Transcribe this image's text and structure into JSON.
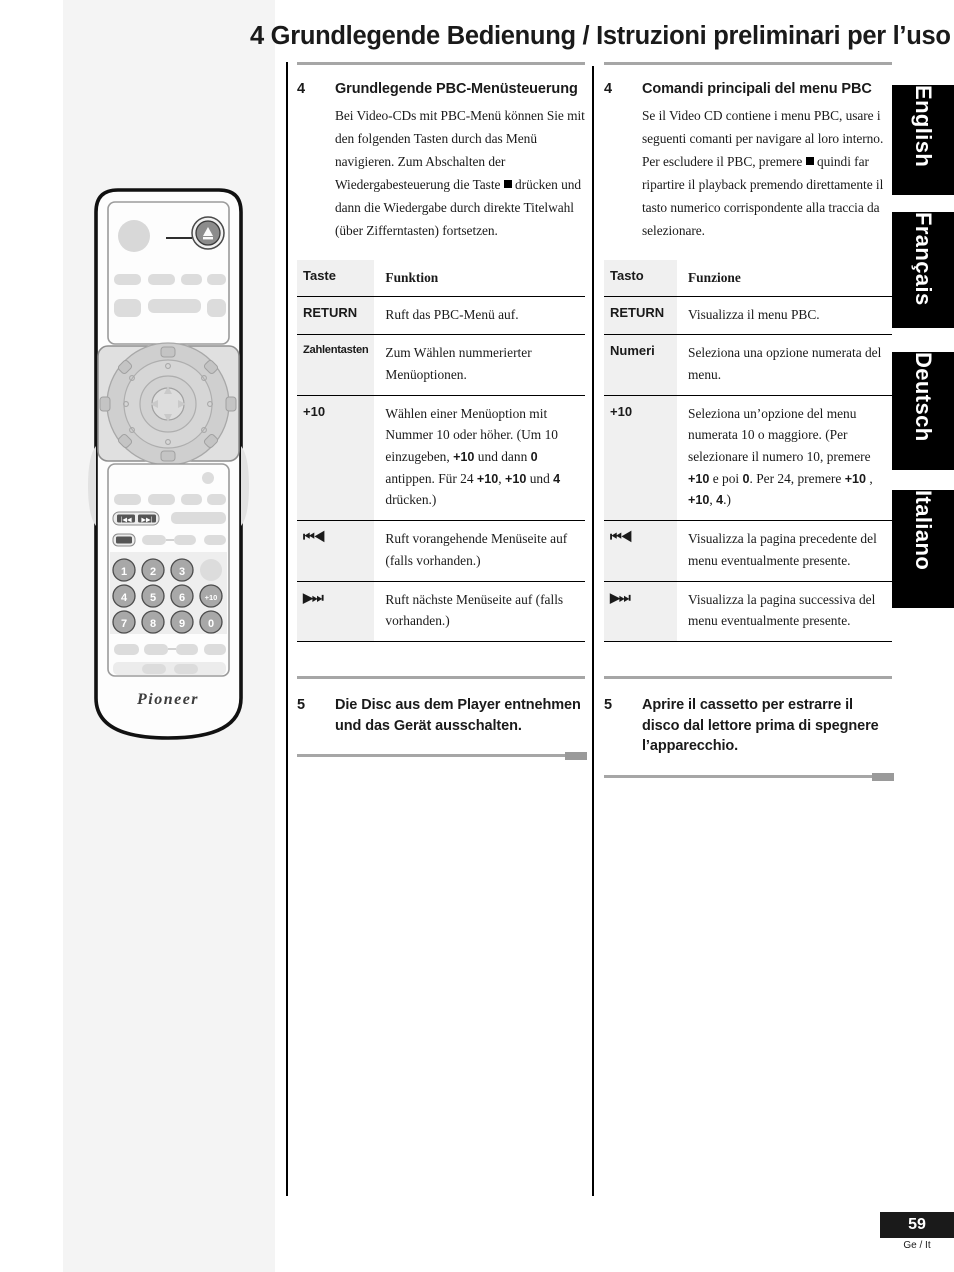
{
  "page": {
    "title": "4 Grundlegende Bedienung / Istruzioni preliminari per l’uso",
    "number": "59",
    "number_sub": "Ge / It"
  },
  "language_tabs": [
    {
      "label": "English"
    },
    {
      "label": "Français"
    },
    {
      "label": "Deutsch"
    },
    {
      "label": "Italiano"
    }
  ],
  "illustration": {
    "brand": "Pioneer",
    "numeric_keys": [
      "1",
      "2",
      "3",
      "4",
      "5",
      "6",
      "+10",
      "7",
      "8",
      "9",
      "0"
    ]
  },
  "german": {
    "step4": {
      "num": "4",
      "title": "Grundlegende PBC-Menüsteuerung",
      "body_before": "Bei Video-CDs mit  PBC-Menü können Sie mit den folgenden Tasten durch das Menü navigieren. Zum Abschalten der Wiedergabesteuerung die Taste",
      "body_after": "drücken und dann die Wiedergabe durch direkte Titelwahl (über Zifferntasten) fortsetzen."
    },
    "table": {
      "head_key": "Taste",
      "head_func": "Funktion",
      "rows": [
        {
          "key": "RETURN",
          "key_small": false,
          "desc": "Ruft das PBC-Menü auf."
        },
        {
          "key": "Zahlentasten",
          "key_small": true,
          "desc": "Zum Wählen nummerierter Menüoptionen."
        },
        {
          "key": "+10",
          "key_small": false,
          "desc": "Wählen einer Menüoption mit Nummer 10 oder höher. (Um 10 einzugeben, +10 und dann 0 antippen. Für 24 +10, +10 und 4 drücken.)"
        },
        {
          "key": "⏮◀",
          "key_small": false,
          "key_glyph": true,
          "desc": "Ruft vorangehende Menüseite auf (falls vorhanden.)"
        },
        {
          "key": "▶⏭",
          "key_small": false,
          "key_glyph": true,
          "desc": "Ruft nächste Menüseite auf (falls vorhanden.)"
        }
      ]
    },
    "step5": {
      "num": "5",
      "title": "Die Disc aus dem Player entnehmen und das Gerät ausschalten."
    }
  },
  "italian": {
    "step4": {
      "num": "4",
      "title": "Comandi principali del menu PBC",
      "body_before": "Se il Video CD contiene i menu PBC, usare i seguenti comanti per navigare al loro interno. Per escludere il PBC, premere",
      "body_after": "quindi far ripartire il playback premendo direttamente il tasto numerico corrispondente alla traccia da selezionare."
    },
    "table": {
      "head_key": "Tasto",
      "head_func": "Funzione",
      "rows": [
        {
          "key": "RETURN",
          "key_small": false,
          "desc": "Visualizza il menu PBC."
        },
        {
          "key": "Numeri",
          "key_small": false,
          "desc": "Seleziona una opzione numerata del menu."
        },
        {
          "key": "+10",
          "key_small": false,
          "desc": "Seleziona un’opzione del menu numerata 10 o maggiore. (Per selezionare il numero 10, premere +10 e poi 0. Per 24, premere +10 , +10, 4.)"
        },
        {
          "key": "⏮◀",
          "key_small": false,
          "key_glyph": true,
          "desc": "Visualizza la pagina precedente del menu eventualmente presente."
        },
        {
          "key": "▶⏭",
          "key_small": false,
          "key_glyph": true,
          "desc": "Visualizza la pagina successiva del menu eventualmente presente."
        }
      ]
    },
    "step5": {
      "num": "5",
      "title": "Aprire il cassetto per estrarre il disco dal lettore prima di spegnere l’apparecchio."
    }
  }
}
